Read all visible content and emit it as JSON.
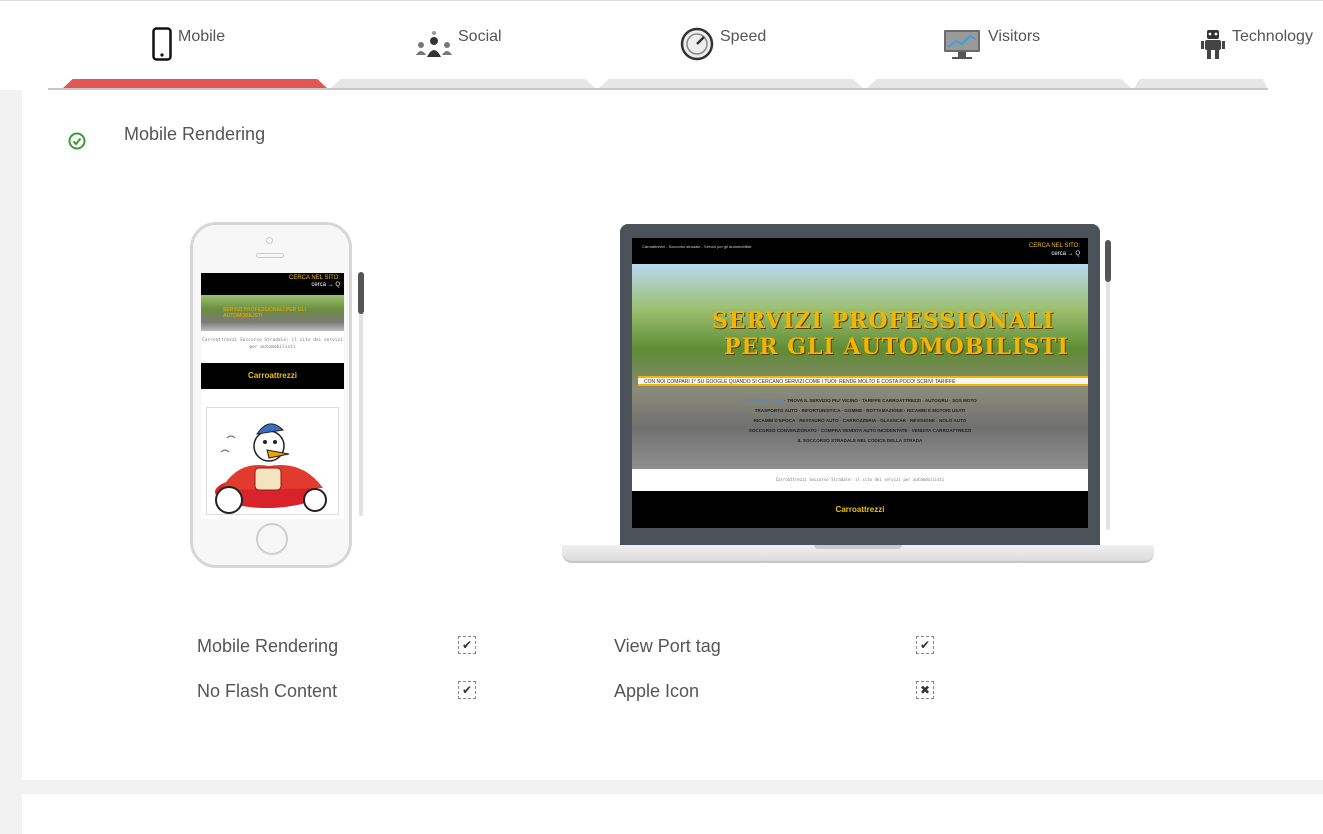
{
  "tabs": [
    {
      "label": "Mobile",
      "icon": "mobile-phone-icon",
      "active": true
    },
    {
      "label": "Social",
      "icon": "social-network-icon",
      "active": false
    },
    {
      "label": "Speed",
      "icon": "speedometer-icon",
      "active": false
    },
    {
      "label": "Visitors",
      "icon": "monitor-chart-icon",
      "active": false
    },
    {
      "label": "Technology",
      "icon": "robot-icon",
      "active": false
    }
  ],
  "colors": {
    "active_tab": "#e25756",
    "check": "#3a9a3a",
    "site_gold": "#f2b600"
  },
  "section": {
    "title": "Mobile Rendering",
    "status_icon": "check-circle-icon"
  },
  "phone_preview": {
    "search": "CERCA NEL SITO:",
    "search_hint": "cerca → Q",
    "hero": "SERVIZI PROFESSIONALI PER GLI AUTOMOBILISTI",
    "tagline": "Carroattrezzi Soccorso Stradale: il sito dei servizi per automobilisti",
    "bar": "Carroattrezzi"
  },
  "laptop_preview": {
    "meta": "Carroattrezzi - Soccorso stradale - Servizi per gli automobilisti",
    "search": "CERCA NEL SITO:",
    "search_hint": "cerca → Q",
    "headline1": "SERVIZI PROFESSIONALI",
    "headline2": "PER GLI AUTOMOBILISTI",
    "ribbon": "CON NOI COMPARI 1° SU GOOGLE QUANDO SI CERCANO SERVIZI COME I TUOI: RENDE MOLTO E COSTA POCO! SCRIVI TARIFFE",
    "links_row1_highlight": "UTILITÀ DEL SITO",
    "links_row1": "TROVA IL SERVIZIO PIU' VICINO · TARIFFE CARROATTREZZI · AUTOGRU · SOS MOTO",
    "links_row2": "TRASPORTO AUTO · INFORTUNISTICA · GOMME · ROTTAMAZIONE · RICAMBI E MOTORI USATI",
    "links_row3": "RICAMBI D'EPOCA · RESTAURO AUTO · CARROZZERIA · GLASSCAR · REVISIONE · NOLO AUTO",
    "links_row4": "SOCCORSO CONVENZIONATO · COMPRA VENDITA AUTO INCIDENTATE · VENDITA CARROATTREZZI",
    "links_row5": "IL SOCCORSO STRADALE NEL CODICE DELLA STRADA",
    "tagline": "Carroattrezzi Soccorso Stradale: il sito dei servizi per automobilisti",
    "bar": "Carroattrezzi"
  },
  "checks": [
    {
      "label": "Mobile Rendering",
      "mark": "✔",
      "passed": true
    },
    {
      "label": "No Flash Content",
      "mark": "✔",
      "passed": true
    },
    {
      "label": "View Port tag",
      "mark": "✔",
      "passed": true
    },
    {
      "label": "Apple Icon",
      "mark": "✖",
      "passed": false
    }
  ]
}
